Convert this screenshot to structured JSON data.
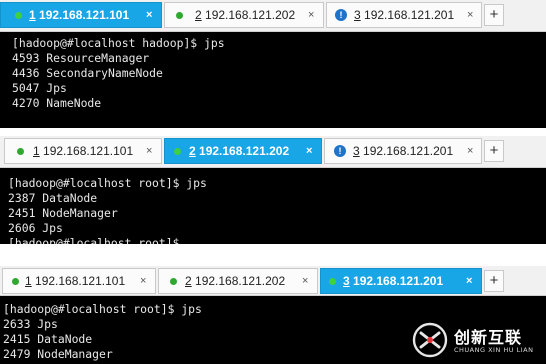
{
  "panels": [
    {
      "tabs": [
        {
          "num": "1",
          "host": "192.168.121.101",
          "status": "connected",
          "close": "×"
        },
        {
          "num": "2",
          "host": "192.168.121.202",
          "status": "connected",
          "close": "×"
        },
        {
          "num": "3",
          "host": "192.168.121.201",
          "status": "warning",
          "warn_glyph": "!",
          "close": "×"
        }
      ],
      "active_tab": 0,
      "plus": "+",
      "lines": [
        "[hadoop@#localhost hadoop]$ jps",
        "4593 ResourceManager",
        "4436 SecondaryNameNode",
        "5047 Jps",
        "4270 NameNode"
      ]
    },
    {
      "tabs": [
        {
          "num": "1",
          "host": "192.168.121.101",
          "status": "connected",
          "close": "×"
        },
        {
          "num": "2",
          "host": "192.168.121.202",
          "status": "connected",
          "close": "×"
        },
        {
          "num": "3",
          "host": "192.168.121.201",
          "status": "warning",
          "warn_glyph": "!",
          "close": "×"
        }
      ],
      "active_tab": 1,
      "plus": "+",
      "lines": [
        "[hadoop@#localhost root]$ jps",
        "2387 DataNode",
        "2451 NodeManager",
        "2606 Jps",
        "[hadoop@#localhost root]$ "
      ]
    },
    {
      "tabs": [
        {
          "num": "1",
          "host": "192.168.121.101",
          "status": "connected",
          "close": "×"
        },
        {
          "num": "2",
          "host": "192.168.121.202",
          "status": "connected",
          "close": "×"
        },
        {
          "num": "3",
          "host": "192.168.121.201",
          "status": "connected",
          "close": "×"
        }
      ],
      "active_tab": 2,
      "plus": "+",
      "lines": [
        "[hadoop@#localhost root]$ jps",
        "2633 Jps",
        "2415 DataNode",
        "2479 NodeManager"
      ]
    }
  ],
  "watermark": {
    "name": "创新互联",
    "sub": "CHUANG XIN HU LIAN"
  }
}
